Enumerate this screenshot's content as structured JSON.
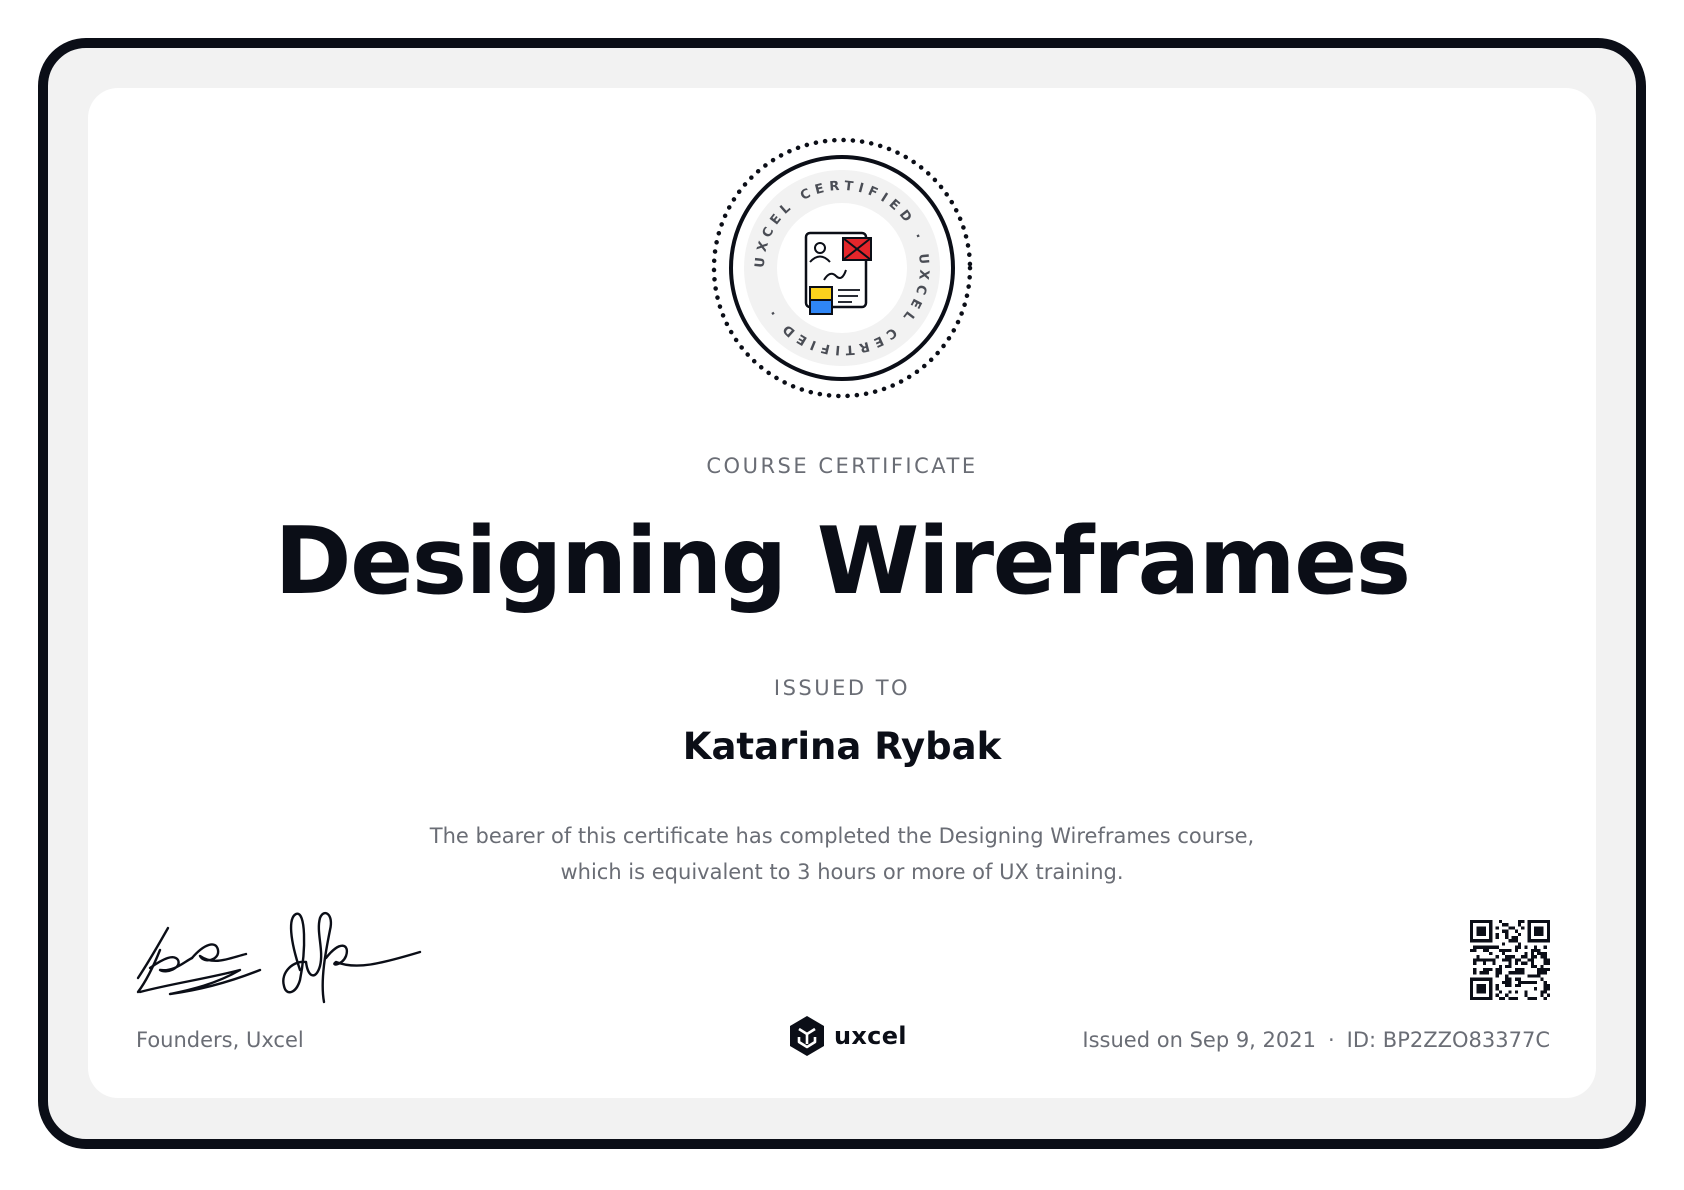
{
  "badge": {
    "ring_text": "UXCEL CERTIFIED · UXCEL CERTIFIED ·",
    "icon": "wireframe-document-icon"
  },
  "certificate": {
    "kicker": "COURSE CERTIFICATE",
    "title": "Designing Wireframes",
    "issued_to_label": "ISSUED TO",
    "recipient": "Katarina Rybak",
    "description_line1": "The bearer of this certificate has completed the Designing Wireframes course,",
    "description_line2": "which is equivalent to 3 hours or more of UX training."
  },
  "footer": {
    "founders": "Founders, Uxcel",
    "logo_text": "uxcel",
    "issued_on": "Issued on Sep 9, 2021",
    "separator": "·",
    "id": "ID: BP2ZZO83377C"
  },
  "colors": {
    "ink": "#0b0e17",
    "muted": "#6a6d75",
    "frame_bg": "#f2f2f2",
    "accent_red": "#e4262b",
    "accent_yellow": "#fcd21d",
    "accent_blue": "#2f86f6"
  }
}
